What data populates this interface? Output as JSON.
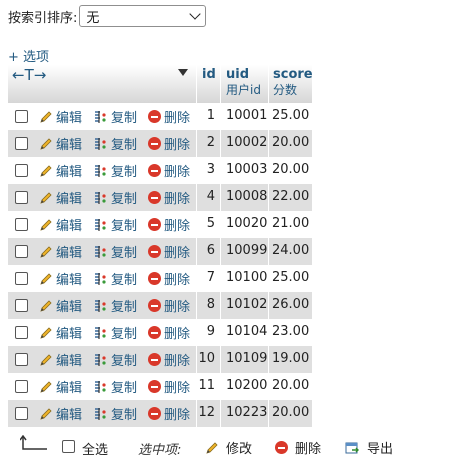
{
  "sort": {
    "label": "按索引排序:",
    "selected": "无"
  },
  "options_label": "+ 选项",
  "header": {
    "arrows": "←T→",
    "columns": [
      {
        "name": "id",
        "subtitle": ""
      },
      {
        "name": "uid",
        "subtitle": "用户id"
      },
      {
        "name": "score",
        "subtitle": "分数"
      }
    ]
  },
  "actions": {
    "edit": "编辑",
    "copy": "复制",
    "delete": "删除"
  },
  "rows": [
    {
      "id": "1",
      "uid": "10001",
      "score": "25.00"
    },
    {
      "id": "2",
      "uid": "10002",
      "score": "20.00"
    },
    {
      "id": "3",
      "uid": "10003",
      "score": "20.00"
    },
    {
      "id": "4",
      "uid": "10008",
      "score": "22.00"
    },
    {
      "id": "5",
      "uid": "10020",
      "score": "21.00"
    },
    {
      "id": "6",
      "uid": "10099",
      "score": "24.00"
    },
    {
      "id": "7",
      "uid": "10100",
      "score": "25.00"
    },
    {
      "id": "8",
      "uid": "10102",
      "score": "26.00"
    },
    {
      "id": "9",
      "uid": "10104",
      "score": "23.00"
    },
    {
      "id": "10",
      "uid": "10109",
      "score": "19.00"
    },
    {
      "id": "11",
      "uid": "10200",
      "score": "20.00"
    },
    {
      "id": "12",
      "uid": "10223",
      "score": "20.00"
    }
  ],
  "footer": {
    "select_all": "全选",
    "with_selected": "选中项:",
    "edit": "修改",
    "delete": "删除",
    "export": "导出"
  },
  "colors": {
    "link": "#235a81",
    "row_alt": "#dfdfdf",
    "delete_red": "#d9382a"
  }
}
